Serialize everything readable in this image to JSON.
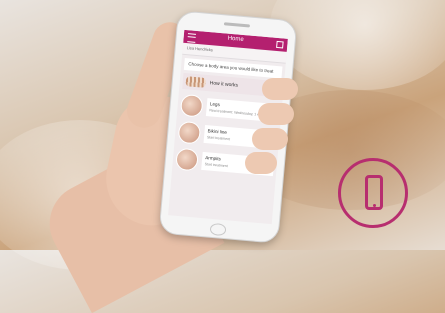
{
  "app": {
    "title": "Home",
    "user": "Lisa Hendricks",
    "prompt": "Choose a body area you would like to treat"
  },
  "how_it_works": {
    "label": "How it works"
  },
  "areas": [
    {
      "name": "Legs",
      "subtitle": "Next treatment: Wednesday, 1 August"
    },
    {
      "name": "Bikini line",
      "subtitle": "Start treatment"
    },
    {
      "name": "Armpits",
      "subtitle": "Start treatment"
    }
  ],
  "colors": {
    "brand": "#b4206f",
    "device_icon": "#b72e6f"
  },
  "icons": {
    "menu": "menu-icon",
    "cart": "cart-icon",
    "device": "smartphone-icon"
  }
}
